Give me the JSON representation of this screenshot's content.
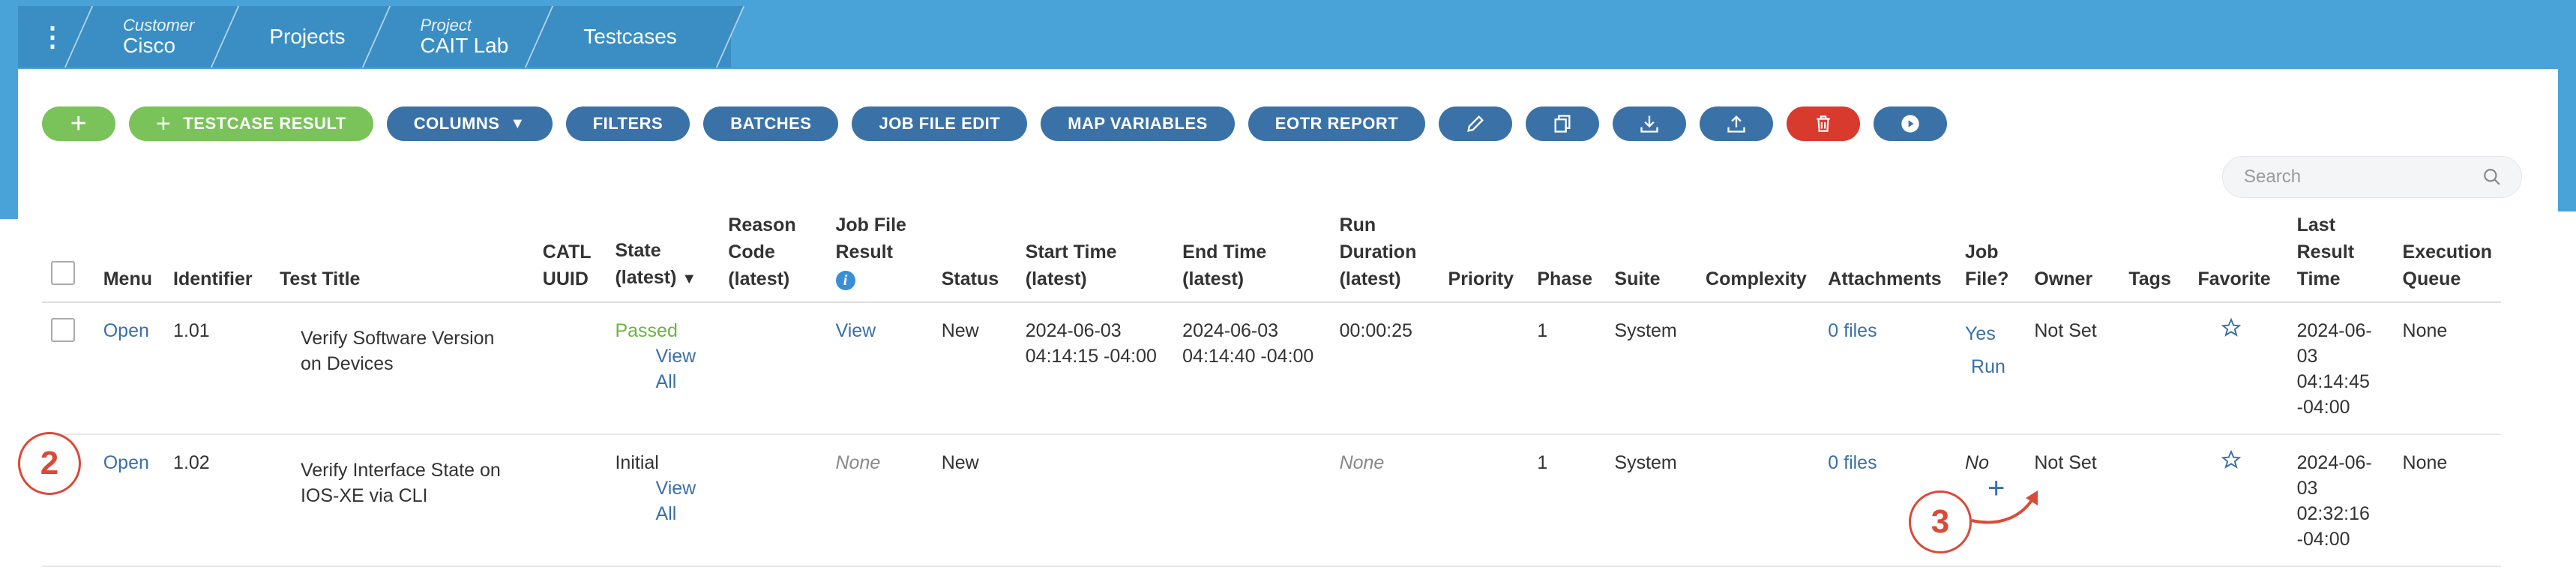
{
  "breadcrumb": {
    "items": [
      {
        "small": "Customer",
        "big": "Cisco"
      },
      {
        "small": "",
        "big": "Projects"
      },
      {
        "small": "Project",
        "big": "CAIT Lab"
      },
      {
        "small": "",
        "big": "Testcases"
      }
    ]
  },
  "toolbar": {
    "add_label": "+",
    "testcase_result_label": "TESTCASE RESULT",
    "columns_label": "COLUMNS",
    "filters_label": "FILTERS",
    "batches_label": "BATCHES",
    "job_file_edit_label": "JOB FILE EDIT",
    "map_variables_label": "MAP VARIABLES",
    "eotr_report_label": "EOTR REPORT"
  },
  "search": {
    "placeholder": "Search"
  },
  "table": {
    "headers": {
      "menu": "Menu",
      "identifier": "Identifier",
      "test_title": "Test Title",
      "catl_uuid_1": "CATL",
      "catl_uuid_2": "UUID",
      "state_1": "State",
      "state_2": "(latest)",
      "state_sort": "▼",
      "reason_1": "Reason",
      "reason_2": "Code",
      "reason_3": "(latest)",
      "jfr_1": "Job File",
      "jfr_2": "Result",
      "status": "Status",
      "start_1": "Start Time",
      "start_2": "(latest)",
      "end": "End Time (latest)",
      "run_1": "Run",
      "run_2": "Duration",
      "run_3": "(latest)",
      "priority": "Priority",
      "phase": "Phase",
      "suite": "Suite",
      "complexity": "Complexity",
      "attachments": "Attachments",
      "jobfile_1": "Job",
      "jobfile_2": "File?",
      "owner": "Owner",
      "tags": "Tags",
      "favorite": "Favorite",
      "last_1": "Last",
      "last_2": "Result",
      "last_3": "Time",
      "exec_1": "Execution",
      "exec_2": "Queue"
    },
    "rows": [
      {
        "menu": "Open",
        "identifier": "1.01",
        "title_1": "Verify Software Version",
        "title_2": "on Devices",
        "state": "Passed",
        "view_all": "View All",
        "job_file_result": "View",
        "status": "New",
        "start_1": "2024-06-03",
        "start_2": "04:14:15 -04:00",
        "end_1": "2024-06-03",
        "end_2": "04:14:40 -04:00",
        "run_duration": "00:00:25",
        "phase": "1",
        "suite": "System",
        "attachments": "0 files",
        "job_file": "Yes",
        "job_file_run": "Run",
        "owner": "Not Set",
        "last_1": "2024-06-",
        "last_2": "03",
        "last_3": "04:14:45",
        "last_4": "-04:00",
        "exec_queue": "None"
      },
      {
        "menu": "Open",
        "identifier": "1.02",
        "title_1": "Verify Interface State on",
        "title_2": "IOS-XE via CLI",
        "state": "Initial",
        "view_all": "View All",
        "job_file_result": "None",
        "status": "New",
        "run_duration": "None",
        "phase": "1",
        "suite": "System",
        "attachments": "0 files",
        "job_file": "No",
        "job_file_add": "+",
        "owner": "Not Set",
        "last_1": "2024-06-",
        "last_2": "03",
        "last_3": "02:32:16",
        "last_4": "-04:00",
        "exec_queue": "None"
      }
    ]
  },
  "annotations": {
    "circle_2": "2",
    "circle_3": "3"
  },
  "colors": {
    "topbar": "#4aa3d8",
    "crumbs": "#3a8ec4",
    "button": "#3a72a8",
    "green": "#79c35a",
    "red": "#d93a2e",
    "annotation": "#d94a38"
  }
}
